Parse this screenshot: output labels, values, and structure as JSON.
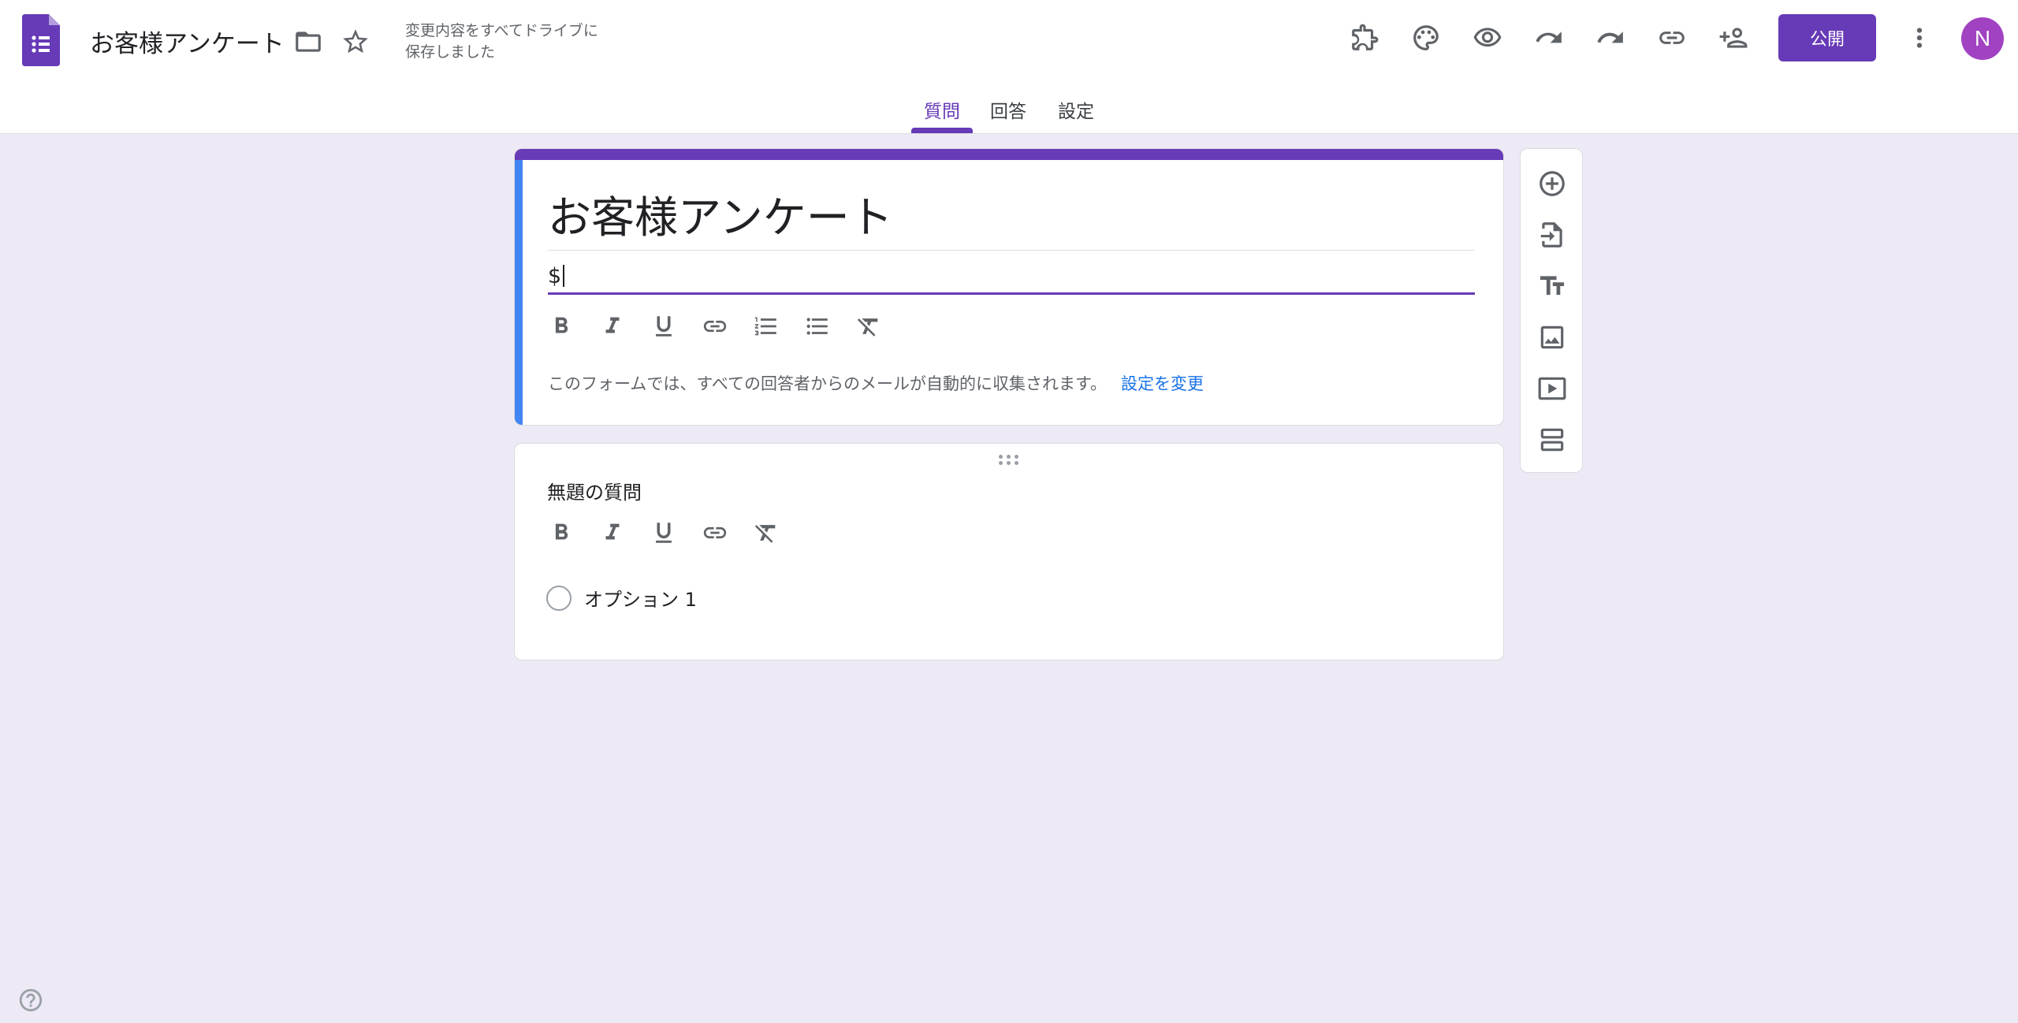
{
  "header": {
    "title": "お客様アンケート",
    "save_status_line1": "変更内容をすべてドライブに",
    "save_status_line2": "保存しました",
    "publish_label": "公開",
    "avatar_initial": "N"
  },
  "tabs": [
    {
      "label": "質問",
      "active": true
    },
    {
      "label": "回答",
      "active": false
    },
    {
      "label": "設定",
      "active": false
    }
  ],
  "form": {
    "title": "お客様アンケート",
    "description_value": "$",
    "email_note": "このフォームでは、すべての回答者からのメールが自動的に収集されます。",
    "email_link": "設定を変更"
  },
  "question": {
    "title": "無題の質問",
    "options": [
      "オプション 1"
    ]
  },
  "colors": {
    "accent": "#673ab7",
    "background": "#ede9f5",
    "link": "#1a73e8",
    "title_left_bar": "#4285f4"
  },
  "icons": {
    "header_left": [
      "forms-logo-icon",
      "folder-icon",
      "star-icon"
    ],
    "header_right": [
      "addon-icon",
      "palette-icon",
      "preview-eye-icon",
      "undo-icon",
      "redo-icon",
      "link-icon",
      "add-collaborator-icon",
      "more-vert-icon"
    ],
    "format_toolbar": [
      "bold-icon",
      "italic-icon",
      "underline-icon",
      "link-icon",
      "numbered-list-icon",
      "bulleted-list-icon",
      "clear-format-icon"
    ],
    "side_toolbar": [
      "add-question-icon",
      "import-questions-icon",
      "add-title-icon",
      "add-image-icon",
      "add-video-icon",
      "add-section-icon"
    ],
    "footer": [
      "help-icon"
    ]
  }
}
